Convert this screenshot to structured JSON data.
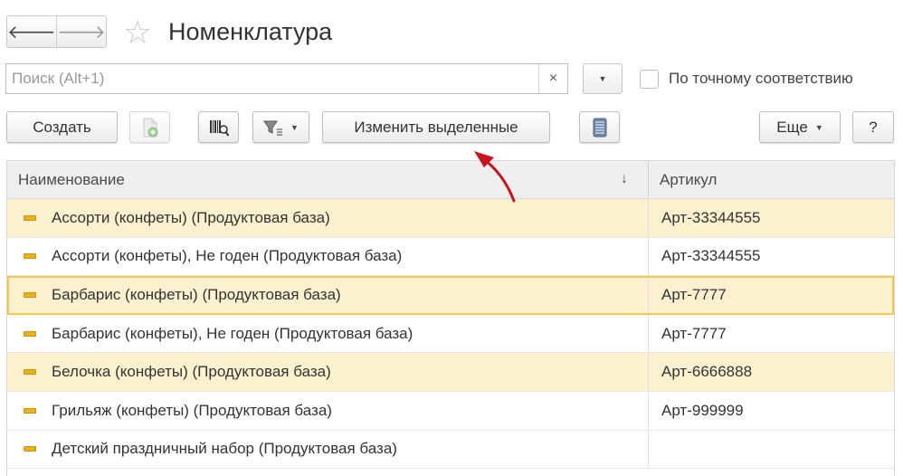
{
  "header": {
    "title": "Номенклатура",
    "back_icon": "arrow-left-icon",
    "forward_icon": "arrow-right-icon",
    "favorite_icon": "star-icon"
  },
  "search": {
    "placeholder": "Поиск (Alt+1)",
    "value": "",
    "clear_label": "×"
  },
  "exact_match": {
    "label": "По точному соответствию",
    "checked": false
  },
  "toolbar": {
    "create_label": "Создать",
    "change_selected_label": "Изменить выделенные",
    "more_label": "Еще",
    "help_label": "?"
  },
  "table": {
    "columns": [
      "Наименование",
      "Артикул"
    ],
    "sort_indicator": "↓",
    "rows": [
      {
        "name": "Ассорти (конфеты) (Продуктовая база)",
        "article": "Арт-33344555",
        "highlight": true
      },
      {
        "name": "Ассорти (конфеты), Не годен (Продуктовая база)",
        "article": "Арт-33344555",
        "highlight": false
      },
      {
        "name": "Барбарис (конфеты) (Продуктовая база)",
        "article": "Арт-7777",
        "highlight": true,
        "selected": true
      },
      {
        "name": "Барбарис (конфеты), Не годен (Продуктовая база)",
        "article": "Арт-7777",
        "highlight": false
      },
      {
        "name": "Белочка (конфеты) (Продуктовая база)",
        "article": "Арт-6666888",
        "highlight": true
      },
      {
        "name": "Грильяж (конфеты) (Продуктовая база)",
        "article": "Арт-999999",
        "highlight": false
      },
      {
        "name": "Детский праздничный набор (Продуктовая база)",
        "article": "",
        "highlight": false
      }
    ]
  },
  "colors": {
    "highlight_row": "#fbf1cf",
    "selected_border": "#f1c94f",
    "annotation_arrow": "#c8141e",
    "item_icon": "#e7b21c"
  }
}
